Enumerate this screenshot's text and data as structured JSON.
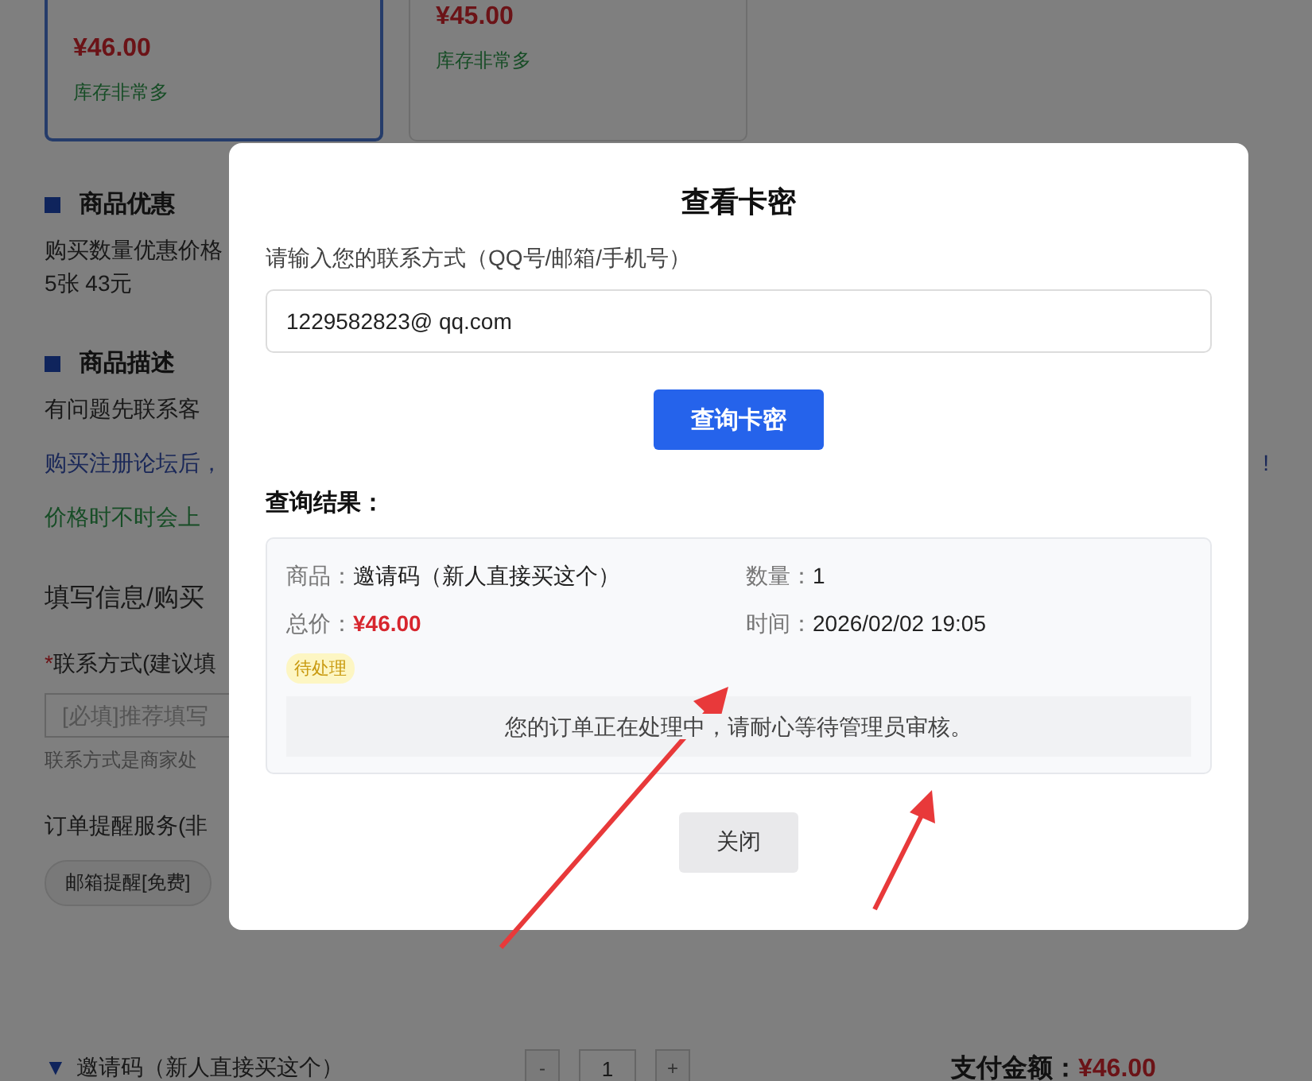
{
  "product_cards": [
    {
      "price": "¥46.00",
      "stock": "库存非常多",
      "selected": true
    },
    {
      "price": "¥45.00",
      "stock": "库存非常多",
      "selected": false
    }
  ],
  "sections": [
    {
      "title": "商品优惠",
      "lines": [
        {
          "kind": "plain",
          "text": "购买数量优惠价格"
        },
        {
          "kind": "plain",
          "text": "5张 43元"
        }
      ]
    },
    {
      "title": "商品描述",
      "lines": [
        {
          "kind": "plain",
          "text": "有问题先联系客"
        },
        {
          "kind": "link",
          "text": "购买注册论坛后，",
          "tail": "!"
        },
        {
          "kind": "note",
          "text": "价格时不时会上"
        }
      ]
    }
  ],
  "form": {
    "title": "填写信息/购买",
    "required_mark": "*",
    "contact_label": "联系方式(建议填",
    "contact_placeholder": "[必填]推荐填写",
    "contact_hint": "联系方式是商家处",
    "reminder_label": "订单提醒服务(非",
    "reminder_options": [
      {
        "label": "邮箱提醒[免费]",
        "selected": false
      }
    ]
  },
  "order_bar": {
    "marker": "▼",
    "product": "邀请码（新人直接买这个）",
    "decrement": "-",
    "quantity": "1",
    "increment": "+",
    "total_label": "支付金额：",
    "total": "¥46.00"
  },
  "dialog": {
    "title": "查看卡密",
    "contact_label": "请输入您的联系方式（QQ号/邮箱/手机号）",
    "contact_value": "1229582823@ qq.com",
    "query_button": "查询卡密",
    "result_title": "查询结果：",
    "result": {
      "fields": [
        {
          "kind": "text",
          "label": "商品：",
          "value": "邀请码（新人直接买这个）"
        },
        {
          "kind": "text",
          "label": "数量：",
          "value": "1"
        },
        {
          "kind": "price",
          "label": "总价：",
          "value": "¥46.00"
        },
        {
          "kind": "text",
          "label": "时间：",
          "value": "2026/02/02 19:05"
        }
      ],
      "status": "待处理",
      "message": "您的订单正在处理中，请耐心等待管理员审核。"
    },
    "close_button": "关闭"
  }
}
